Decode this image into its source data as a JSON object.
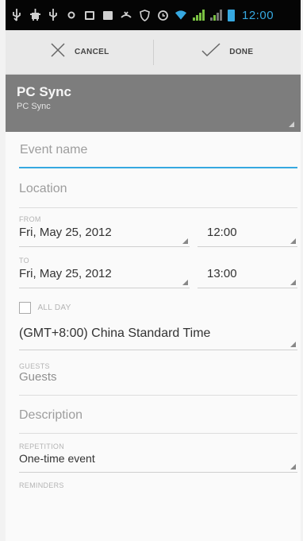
{
  "status_bar": {
    "time": "12:00"
  },
  "action_bar": {
    "cancel_label": "CANCEL",
    "done_label": "DONE"
  },
  "account": {
    "name": "PC Sync",
    "subtitle": "PC Sync"
  },
  "form": {
    "event_name_placeholder": "Event name",
    "location_placeholder": "Location",
    "from_label": "FROM",
    "from_date": "Fri, May 25, 2012",
    "from_time": "12:00",
    "to_label": "TO",
    "to_date": "Fri, May 25, 2012",
    "to_time": "13:00",
    "all_day_label": "ALL DAY",
    "timezone": "(GMT+8:00) China Standard Time",
    "guests_label": "GUESTS",
    "guests_placeholder": "Guests",
    "description_placeholder": "Description",
    "repetition_label": "REPETITION",
    "repetition_value": "One-time event",
    "reminders_label": "REMINDERS"
  },
  "colors": {
    "accent": "#36a8e0",
    "account_header": "#7d7d7d",
    "action_bar": "#e9e9e9"
  }
}
